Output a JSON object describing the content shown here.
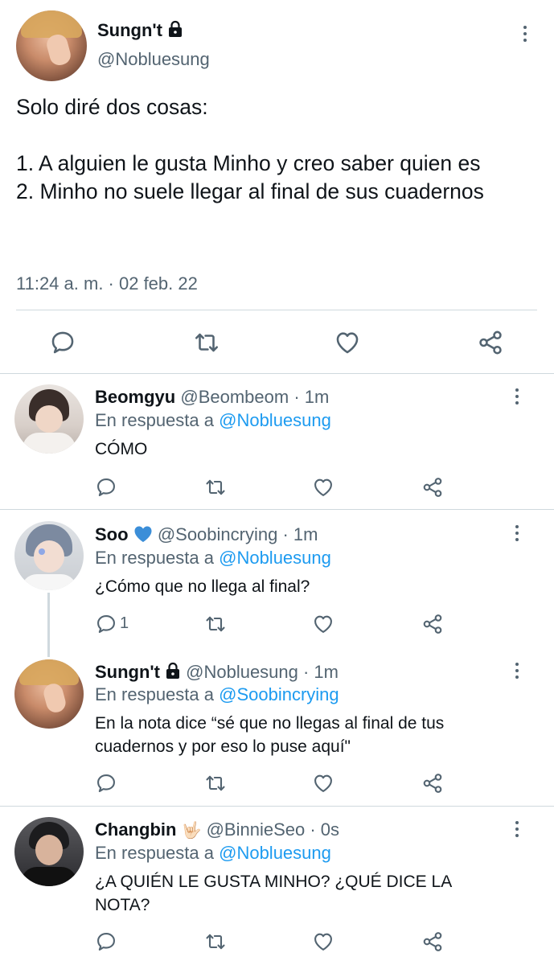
{
  "main_tweet": {
    "display_name": "Sungn't",
    "handle": "@Nobluesung",
    "body": "Solo diré dos cosas:\n\n1. A alguien le gusta Minho y creo saber quien es\n2. Minho no suele llegar al final de sus cuadernos",
    "timestamp": "11:24 a. m. · 02 feb. 22"
  },
  "replies": [
    {
      "display_name": "Beomgyu",
      "meta": "@Beombeom · 1m",
      "reply_prefix": "En respuesta a",
      "reply_to": "@Nobluesung",
      "text": "CÓMO",
      "reply_count": ""
    },
    {
      "display_name": "Soo",
      "emoji": "💙",
      "meta": "@Soobincrying · 1m",
      "reply_prefix": "En respuesta a",
      "reply_to": "@Nobluesung",
      "text": "¿Cómo que no llega al final?",
      "reply_count": "1"
    },
    {
      "display_name": "Sungn't",
      "meta": "@Nobluesung · 1m",
      "reply_prefix": "En respuesta a",
      "reply_to": "@Soobincrying",
      "text": "En la nota dice “sé que no llegas al final de tus\ncuadernos y por eso lo puse aquí\"",
      "reply_count": ""
    },
    {
      "display_name": "Changbin",
      "emoji": "🤟🏻",
      "meta": "@BinnieSeo · 0s",
      "reply_prefix": "En respuesta a",
      "reply_to": "@Nobluesung",
      "text": "¿A QUIÉN LE GUSTA MINHO? ¿QUÉ DICE LA\nNOTA?",
      "reply_count": ""
    }
  ],
  "icons": {
    "reply": "speech-bubble-icon",
    "retweet": "retweet-icon",
    "like": "heart-icon",
    "share": "share-icon",
    "more": "kebab-menu-icon",
    "lock": "lock-icon"
  },
  "colors": {
    "link": "#1d9bf0",
    "secondary_text": "#536471",
    "separator": "#cfd9de",
    "emoji_heart": "#3b8ed8"
  }
}
